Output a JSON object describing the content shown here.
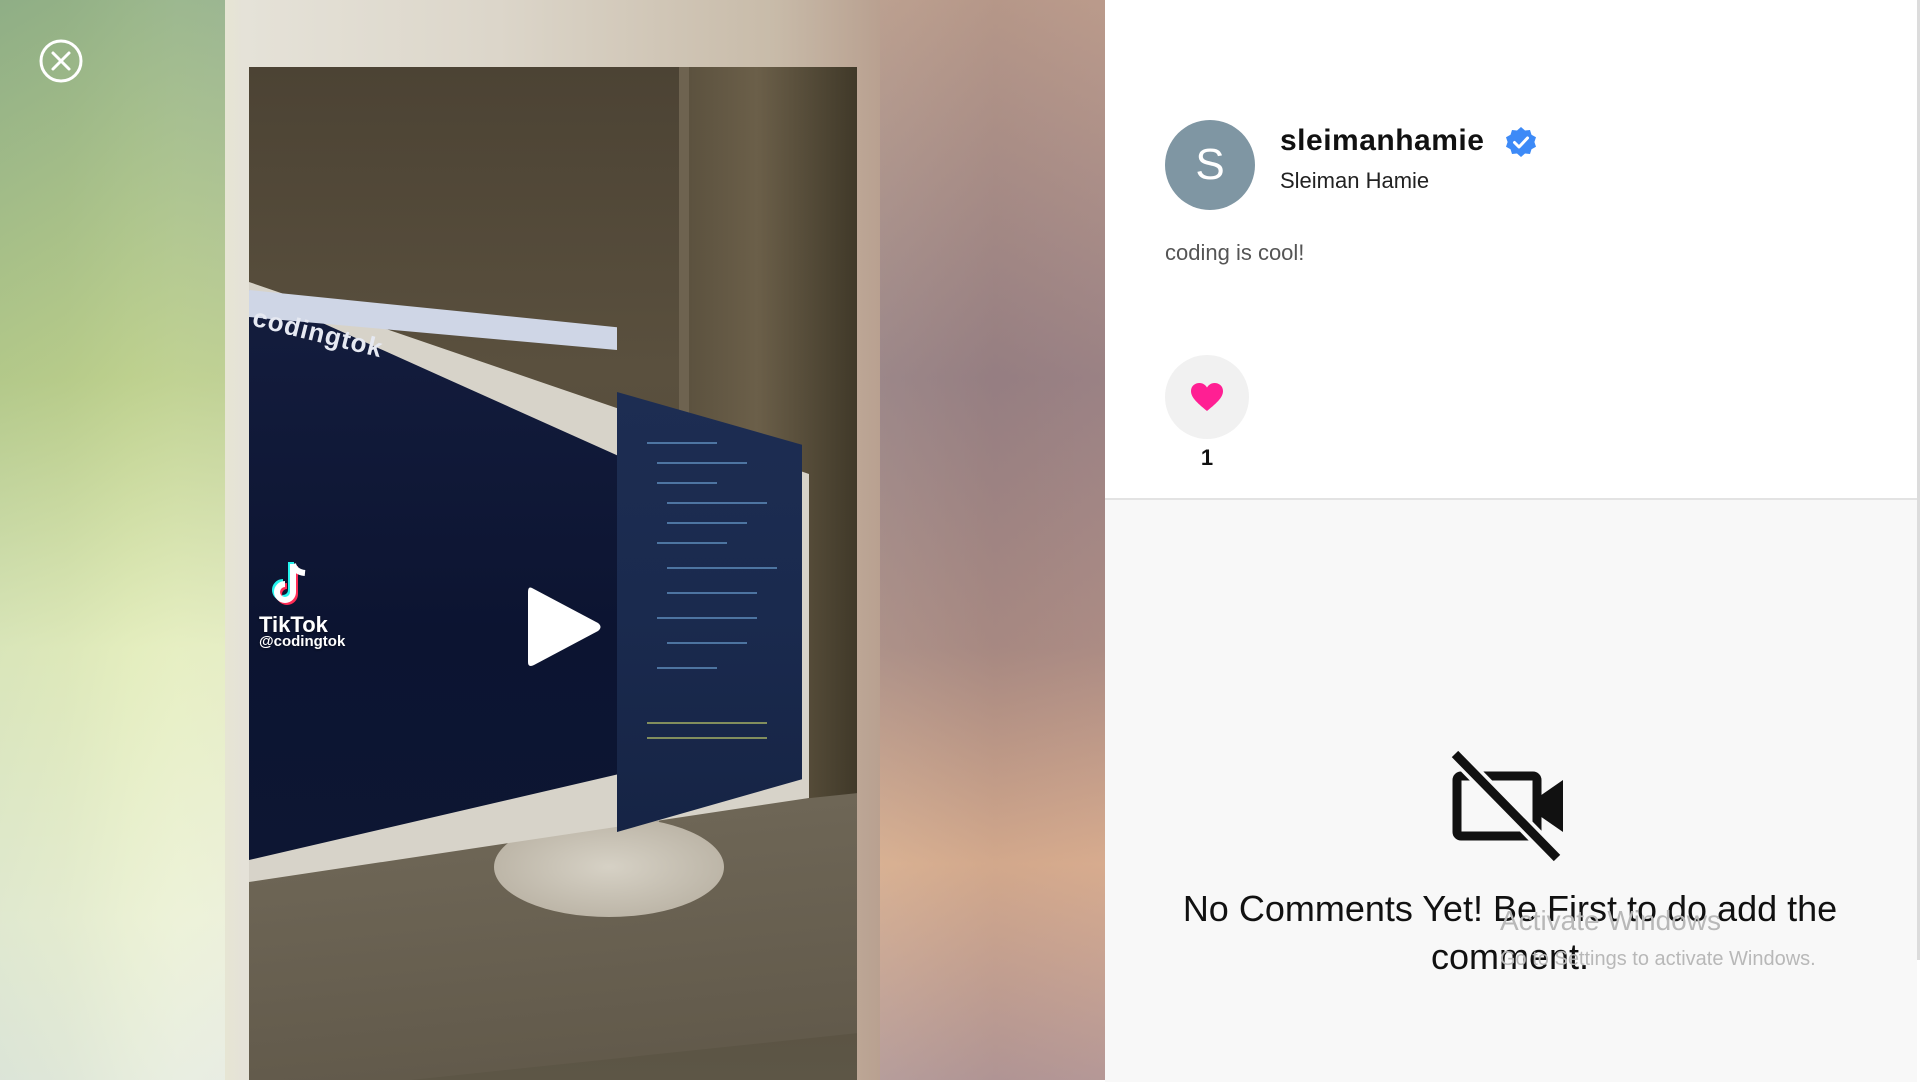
{
  "close_button": {
    "icon": "close-circle-icon"
  },
  "video": {
    "screen_brand_text": "codingtok",
    "watermark_brand": "TikTok",
    "watermark_handle": "@codingtok",
    "play_icon": "play-icon"
  },
  "post": {
    "avatar_initial": "S",
    "username": "sleimanhamie",
    "verified": true,
    "full_name": "Sleiman Hamie",
    "caption": "coding is cool!",
    "like_count": "1",
    "like_color": "#ff1f93"
  },
  "comments": {
    "empty_message": "No Comments Yet! Be First to do add the comment.",
    "empty_icon": "video-off-icon"
  },
  "os_watermark": {
    "title": "Activate Windows",
    "subtitle": "Go to Settings to activate Windows."
  },
  "colors": {
    "verified_blue": "#3d8af7",
    "avatar_bg": "#7f96a3"
  }
}
